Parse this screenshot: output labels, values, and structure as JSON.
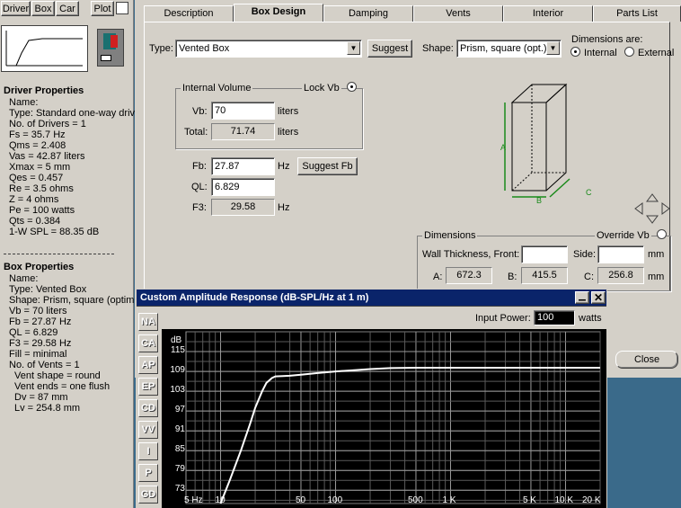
{
  "toolbar": {
    "driver": "Driver",
    "box": "Box",
    "car": "Car",
    "plot": "Plot"
  },
  "driver_properties": {
    "heading": "Driver Properties",
    "lines": [
      "Name:",
      "Type: Standard one-way driv",
      "No. of Drivers = 1",
      "Fs = 35.7 Hz",
      "Qms = 2.408",
      "Vas = 42.87 liters",
      "Xmax = 5 mm",
      "Qes = 0.457",
      "Re = 3.5 ohms",
      "Z = 4 ohms",
      "Pe = 100 watts",
      "Qts = 0.384",
      "1-W SPL = 88.35 dB"
    ]
  },
  "box_properties": {
    "heading": "Box Properties",
    "lines": [
      "Name:",
      "Type: Vented Box",
      "Shape: Prism, square (optimu",
      "Vb = 70 liters",
      "Fb = 27.87 Hz",
      "QL = 6.829",
      "F3 = 29.58 Hz",
      "Fill = minimal",
      "No. of Vents = 1",
      "Vent shape = round",
      "Vent ends = one flush",
      "Dv = 87 mm",
      "Lv = 254.8 mm"
    ]
  },
  "tabs": [
    "Description",
    "Box Design",
    "Damping",
    "Vents",
    "Interior",
    "Parts List"
  ],
  "box_design": {
    "type_label": "Type:",
    "type_value": "Vented Box",
    "suggest": "Suggest",
    "shape_label": "Shape:",
    "shape_value": "Prism, square (opt.)",
    "dims_are_label": "Dimensions are:",
    "internal": "Internal",
    "external": "External",
    "internal_volume": "Internal Volume",
    "lock_vb": "Lock Vb",
    "vb_label": "Vb:",
    "vb_value": "70",
    "liters": "liters",
    "total_label": "Total:",
    "total_value": "71.74",
    "fb_label": "Fb:",
    "fb_value": "27.87",
    "hz": "Hz",
    "suggest_fb": "Suggest Fb",
    "ql_label": "QL:",
    "ql_value": "6.829",
    "f3_label": "F3:",
    "f3_value": "29.58",
    "box_labels": {
      "a": "A",
      "b": "B",
      "c": "C"
    },
    "dimensions": "Dimensions",
    "override_vb": "Override Vb",
    "wall_thickness": "Wall Thickness, Front:",
    "side_label": "Side:",
    "mm": "mm",
    "a_label": "A:",
    "a_value": "672.3",
    "b_label": "B:",
    "b_value": "415.5",
    "c_label": "C:",
    "c_value": "256.8",
    "close": "Close"
  },
  "plot_window": {
    "title": "Custom Amplitude Response (dB-SPL/Hz at 1 m)",
    "input_power_label": "Input Power:",
    "input_power_value": "100",
    "watts": "watts",
    "side_buttons": [
      "NA",
      "CA",
      "AP",
      "EP",
      "CD",
      "VV",
      "I",
      "P",
      "GD"
    ]
  },
  "chart_data": {
    "type": "line",
    "title": "Custom Amplitude Response (dB-SPL/Hz at 1 m)",
    "ylabel": "dB",
    "x_scale": "log",
    "xlim": [
      5,
      20000
    ],
    "ylim": [
      69,
      121
    ],
    "yticks": [
      115,
      109,
      103,
      97,
      91,
      85,
      79,
      73
    ],
    "xticks": [
      {
        "v": 5,
        "label": "5 Hz"
      },
      {
        "v": 10,
        "label": "10"
      },
      {
        "v": 50,
        "label": "50"
      },
      {
        "v": 100,
        "label": "100"
      },
      {
        "v": 500,
        "label": "500"
      },
      {
        "v": 1000,
        "label": "1 K"
      },
      {
        "v": 5000,
        "label": "5 K"
      },
      {
        "v": 10000,
        "label": "10 K"
      },
      {
        "v": 20000,
        "label": "20 K"
      }
    ],
    "grid": true,
    "series": [
      {
        "color": "#ffffff",
        "x": [
          10,
          12,
          15,
          18,
          20,
          23,
          25,
          28,
          30,
          35,
          40,
          50,
          70,
          100,
          150,
          200,
          300,
          500,
          1000,
          2000,
          5000,
          20000
        ],
        "values": [
          69,
          76,
          85,
          93,
          98,
          103,
          105.5,
          107,
          107.5,
          107.6,
          107.7,
          108,
          108.5,
          109,
          109.4,
          109.7,
          110,
          110.1,
          110.1,
          110.1,
          110.1,
          110.1
        ]
      }
    ]
  }
}
